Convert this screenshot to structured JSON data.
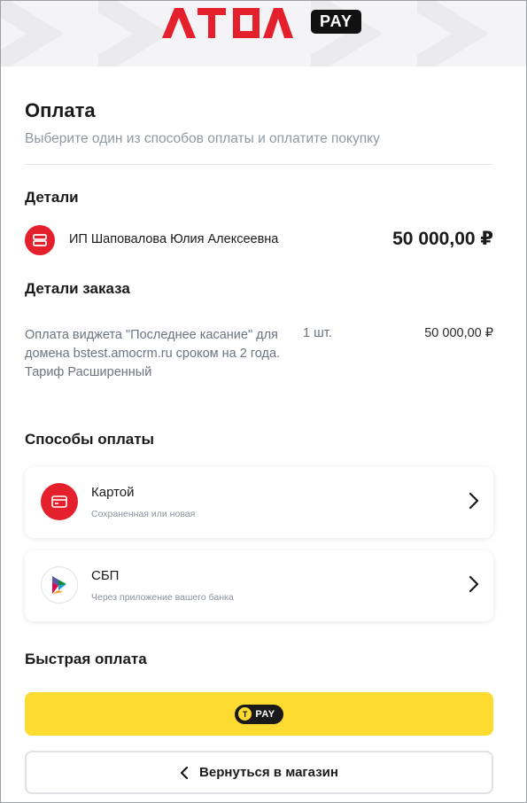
{
  "header": {
    "logo_text": "ATOL",
    "logo_badge": "PAY",
    "brand_color": "#e3202b"
  },
  "page": {
    "title": "Оплата",
    "subtitle": "Выберите один из способов оплаты и оплатите покупку"
  },
  "details": {
    "heading": "Детали",
    "merchant": "ИП Шаповалова Юлия Алексеевна",
    "merchant_icon": "merchant-icon",
    "amount": "50 000,00 ₽"
  },
  "order": {
    "heading": "Детали заказа",
    "items": [
      {
        "description": "Оплата виджета \"Последнее касание\" для домена bstest.amocrm.ru сроком на 2 года. Тариф Расширенный",
        "quantity": "1 шт.",
        "price": "50 000,00 ₽"
      }
    ]
  },
  "payment_methods": {
    "heading": "Способы оплаты",
    "items": [
      {
        "label": "Картой",
        "sublabel": "Сохраненная или новая",
        "icon": "card-icon"
      },
      {
        "label": "СБП",
        "sublabel": "Через приложение вашего банка",
        "icon": "sbp-icon"
      }
    ]
  },
  "fast_payment": {
    "heading": "Быстрая оплата",
    "button_badge": "PAY",
    "button_color": "#fddb30"
  },
  "back_button": {
    "label": "Вернуться в магазин"
  }
}
